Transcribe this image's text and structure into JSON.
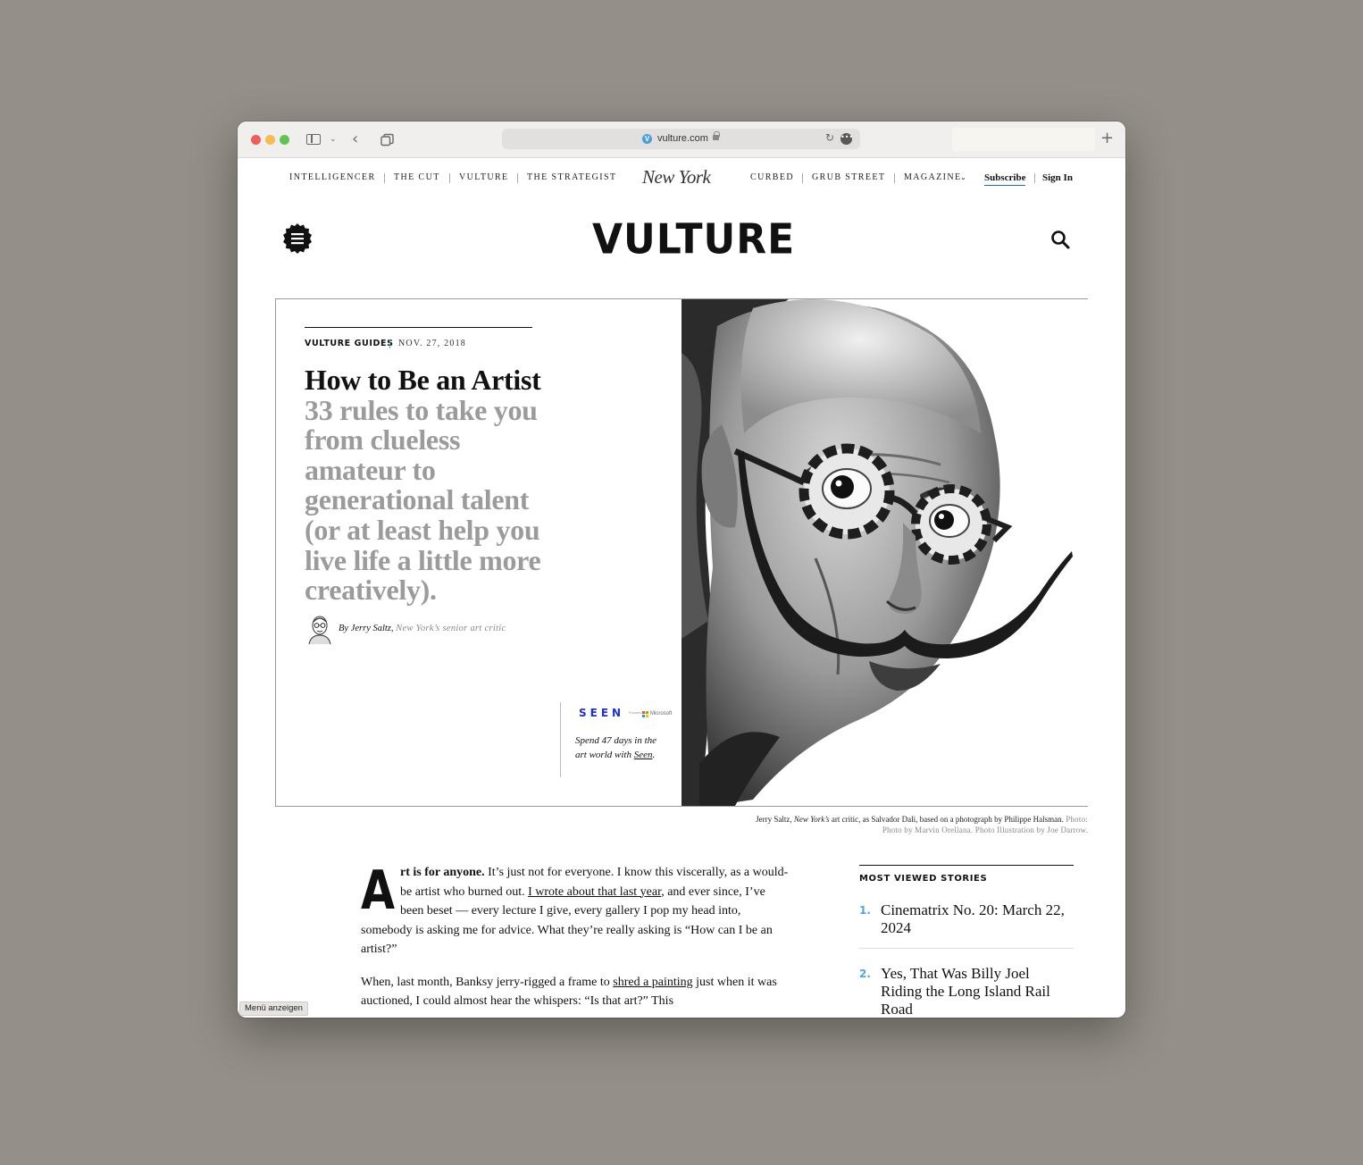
{
  "browser": {
    "url": "vulture.com",
    "favicon_letter": "V"
  },
  "topnav": {
    "left": [
      "INTELLIGENCER",
      "THE CUT",
      "VULTURE",
      "THE STRATEGIST"
    ],
    "brand": "New York",
    "right": [
      "CURBED",
      "GRUB STREET",
      "MAGAZINE"
    ],
    "subscribe": "Subscribe",
    "sign_in": "Sign In"
  },
  "site": {
    "logo": "VULTURE"
  },
  "hero": {
    "rubric": "VULTURE GUIDES",
    "date": "NOV. 27, 2018",
    "headline": "How to Be an Artist",
    "dek": "33 rules to take you from clueless amateur to generational talent (or at least help you live life a little more creatively).",
    "byline_author": "By Jerry Saltz,",
    "byline_role": "New York’s senior art critic",
    "promo": {
      "brand": "SEEN",
      "powered_by": "Powered by",
      "partner": "Microsoft",
      "copy_before": "Spend 47 days in the art world with ",
      "copy_link": "Seen",
      "copy_after": "."
    }
  },
  "caption": {
    "text_1": "Jerry Saltz, ",
    "text_italic": "New York’s",
    "text_2": " art critic, as Salvador Dali, based on a photograph by Philippe Halsman.",
    "credit_label": " Photo:",
    "credit": "Photo by Marvin Orellana. Photo Illustration by Joe Darrow."
  },
  "article": {
    "dropcap": "A",
    "p1_lead": "rt is for anyone.",
    "p1_a": " It’s just not for everyone. I know this viscerally, as a would-be artist who burned out. ",
    "p1_link": "I wrote about that last year",
    "p1_b": ", and ever since, I’ve been beset — every lecture I give, every gallery I pop my head into, somebody is asking me for advice. What they’re really asking is “How can I be an artist?”",
    "p2_a": "When, last month, Banksy jerry-rigged a frame to ",
    "p2_link": "shred a painting",
    "p2_b": " just when it was auctioned, I could almost hear the whispers: “Is that art?” This"
  },
  "sidebar": {
    "title": "MOST VIEWED STORIES",
    "items": [
      {
        "num": "1.",
        "title": "Cinematrix No. 20: March 22, 2024"
      },
      {
        "num": "2.",
        "title": "Yes, That Was Billy Joel Riding the Long Island Rail Road"
      }
    ]
  },
  "tooltip": "Menü anzeigen"
}
